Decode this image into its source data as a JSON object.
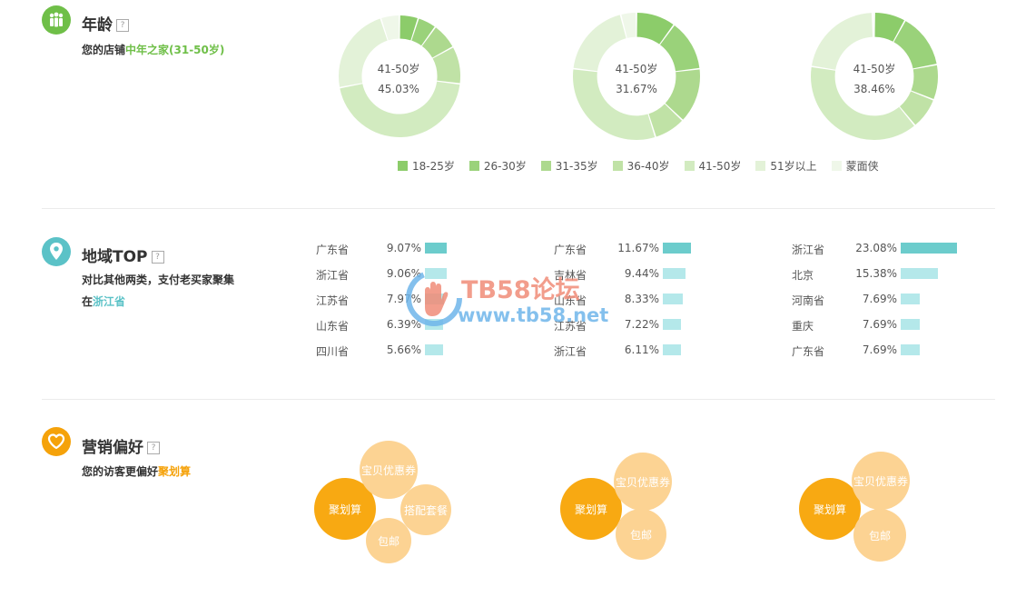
{
  "age": {
    "title": "年龄",
    "help": "?",
    "desc_prefix": "您的店铺",
    "desc_highlight": "中年之家(31-50岁)",
    "charts": [
      {
        "label": "41-50岁",
        "value": "45.03%"
      },
      {
        "label": "41-50岁",
        "value": "31.67%"
      },
      {
        "label": "41-50岁",
        "value": "38.46%"
      }
    ],
    "legend": [
      {
        "label": "18-25岁",
        "color": "#8ccc6a"
      },
      {
        "label": "26-30岁",
        "color": "#9ad27a"
      },
      {
        "label": "31-35岁",
        "color": "#add98e"
      },
      {
        "label": "36-40岁",
        "color": "#c0e2a6"
      },
      {
        "label": "41-50岁",
        "color": "#d2ebc0"
      },
      {
        "label": "51岁以上",
        "color": "#e3f2d8"
      },
      {
        "label": "蒙面侠",
        "color": "#eff7e9"
      }
    ],
    "colors": {
      "accent": "#6fbf48"
    }
  },
  "chart_data": [
    {
      "type": "pie",
      "categories": [
        "18-25岁",
        "26-30岁",
        "31-35岁",
        "36-40岁",
        "41-50岁",
        "51岁以上",
        "蒙面侠"
      ],
      "values": [
        5,
        5,
        7,
        10,
        45.03,
        23,
        5
      ]
    },
    {
      "type": "pie",
      "categories": [
        "18-25岁",
        "26-30岁",
        "31-35岁",
        "36-40岁",
        "41-50岁",
        "51岁以上",
        "蒙面侠"
      ],
      "values": [
        10,
        13,
        14,
        8,
        31.67,
        19,
        4
      ]
    },
    {
      "type": "pie",
      "categories": [
        "18-25岁",
        "26-30岁",
        "31-35岁",
        "36-40岁",
        "41-50岁",
        "51岁以上",
        "蒙面侠"
      ],
      "values": [
        8,
        14,
        9,
        8,
        38.46,
        22,
        0.5
      ]
    }
  ],
  "region": {
    "title": "地域TOP",
    "help": "?",
    "desc_line1": "对比其他两类，支付老买家聚集",
    "desc_prefix": "在",
    "desc_highlight": "浙江省",
    "bar_colors": {
      "top": "#6ccccc",
      "rest": "#b4e8ea"
    },
    "columns": [
      [
        {
          "name": "广东省",
          "pct": "9.07%",
          "value": 9.07
        },
        {
          "name": "浙江省",
          "pct": "9.06%",
          "value": 9.06
        },
        {
          "name": "江苏省",
          "pct": "7.97%",
          "value": 7.97
        },
        {
          "name": "山东省",
          "pct": "6.39%",
          "value": 6.39
        },
        {
          "name": "四川省",
          "pct": "5.66%",
          "value": 5.66
        }
      ],
      [
        {
          "name": "广东省",
          "pct": "11.67%",
          "value": 11.67
        },
        {
          "name": "吉林省",
          "pct": "9.44%",
          "value": 9.44
        },
        {
          "name": "山东省",
          "pct": "8.33%",
          "value": 8.33
        },
        {
          "name": "江苏省",
          "pct": "7.22%",
          "value": 7.22
        },
        {
          "name": "浙江省",
          "pct": "6.11%",
          "value": 6.11
        }
      ],
      [
        {
          "name": "浙江省",
          "pct": "23.08%",
          "value": 23.08
        },
        {
          "name": "北京",
          "pct": "15.38%",
          "value": 15.38
        },
        {
          "name": "河南省",
          "pct": "7.69%",
          "value": 7.69
        },
        {
          "name": "重庆",
          "pct": "7.69%",
          "value": 7.69
        },
        {
          "name": "广东省",
          "pct": "7.69%",
          "value": 7.69
        }
      ]
    ],
    "colors": {
      "accent": "#5bc2c7"
    }
  },
  "marketing": {
    "title": "营销偏好",
    "help": "?",
    "desc_prefix": "您的访客更偏好",
    "desc_highlight": "聚划算",
    "groups": [
      [
        "聚划算",
        "宝贝优惠券",
        "搭配套餐",
        "包邮"
      ],
      [
        "聚划算",
        "宝贝优惠券",
        "包邮"
      ],
      [
        "聚划算",
        "宝贝优惠券",
        "包邮"
      ]
    ],
    "colors": {
      "accent": "#f5a20a",
      "main_bubble": "#f8a912",
      "sub_bubble": "#fcd393"
    }
  },
  "watermark": {
    "line1": "TB58论坛",
    "line2": "www.tb58.net"
  }
}
